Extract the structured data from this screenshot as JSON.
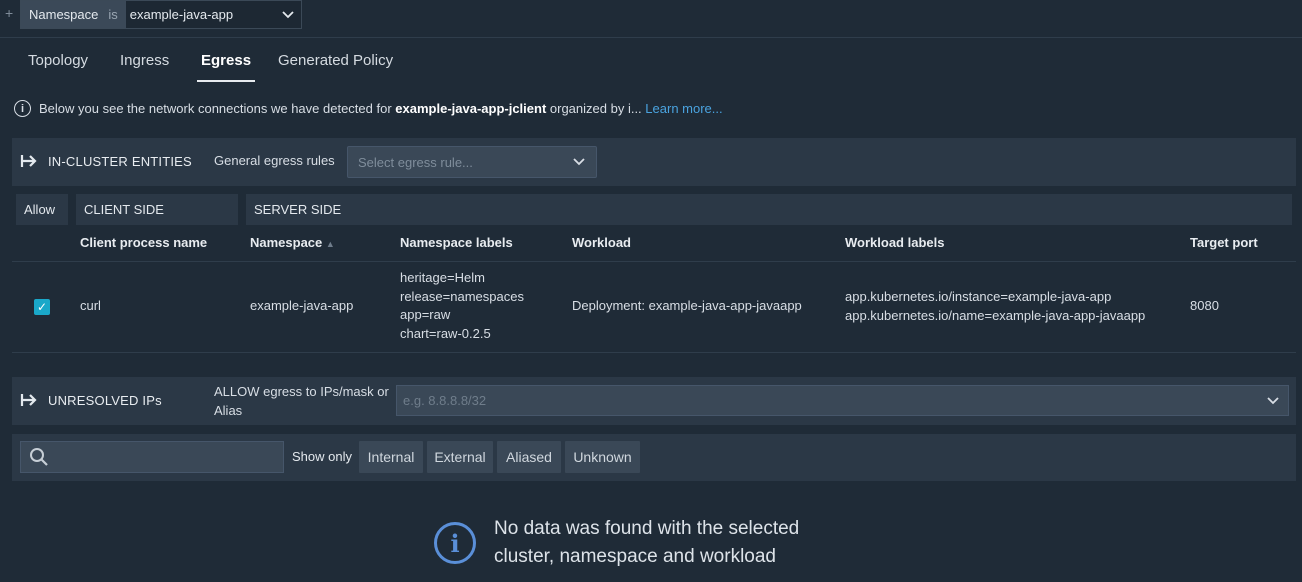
{
  "filter": {
    "plus": "+",
    "key": "Namespace",
    "operator": "is",
    "value": "example-java-app"
  },
  "tabs": [
    {
      "label": "Topology"
    },
    {
      "label": "Ingress"
    },
    {
      "label": "Egress"
    },
    {
      "label": "Generated Policy"
    }
  ],
  "info": {
    "prefix": "Below you see the network connections we have detected for ",
    "entity": "example-java-app-jclient",
    "suffix": " organized by i...",
    "link": "Learn more..."
  },
  "in_cluster": {
    "title": "IN-CLUSTER ENTITIES",
    "rules_label": "General egress rules",
    "rules_placeholder": "Select egress rule..."
  },
  "groups": {
    "allow": "Allow",
    "client": "CLIENT SIDE",
    "server": "SERVER SIDE"
  },
  "columns": {
    "client_process": "Client process name",
    "namespace": "Namespace",
    "namespace_sort": "▲",
    "namespace_labels": "Namespace labels",
    "workload": "Workload",
    "workload_labels": "Workload labels",
    "target_port": "Target port"
  },
  "rows": [
    {
      "allowed": true,
      "process": "curl",
      "namespace": "example-java-app",
      "ns_labels": [
        "heritage=Helm",
        "release=namespaces",
        "app=raw",
        "chart=raw-0.2.5"
      ],
      "workload": "Deployment: example-java-app-javaapp",
      "wl_labels": [
        "app.kubernetes.io/instance=example-java-app",
        "app.kubernetes.io/name=example-java-app-javaapp"
      ],
      "port": "8080"
    }
  ],
  "unresolved": {
    "title": "UNRESOLVED IPs",
    "allow_label_1": "ALLOW egress to IPs/mask or",
    "allow_label_2": "Alias",
    "ip_placeholder": "e.g. 8.8.8.8/32"
  },
  "ip_filter": {
    "show_only": "Show only",
    "buttons": [
      "Internal",
      "External",
      "Aliased",
      "Unknown"
    ]
  },
  "empty": {
    "line1": "No data was found with the selected",
    "line2": "cluster, namespace and workload"
  }
}
